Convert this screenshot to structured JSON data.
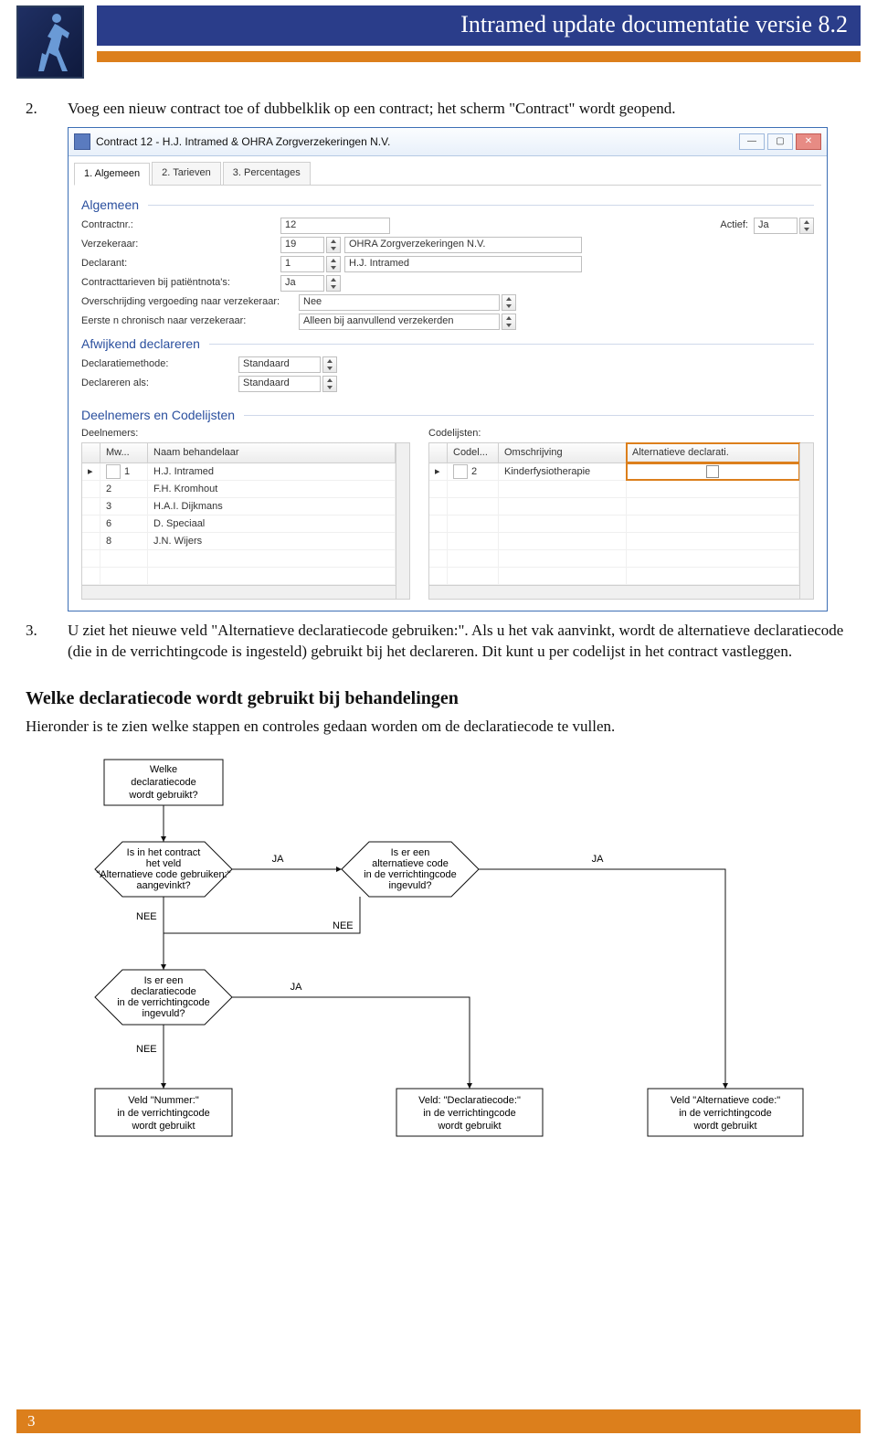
{
  "header": {
    "title": "Intramed update documentatie versie 8.2"
  },
  "steps": {
    "s2_num": "2.",
    "s2_text": "Voeg een nieuw contract toe of dubbelklik op een contract; het scherm \"Contract\" wordt geopend.",
    "s3_num": "3.",
    "s3_text": "U ziet het nieuwe veld \"Alternatieve declaratiecode gebruiken:\". Als u het vak aanvinkt, wordt de alternatieve declaratiecode (die in de verrichtingcode is ingesteld) gebruikt bij het declareren. Dit kunt u per codelijst in het contract vastleggen."
  },
  "dialog": {
    "title": "Contract 12 - H.J. Intramed & OHRA Zorgverzekeringen N.V.",
    "tabs": [
      "1. Algemeen",
      "2. Tarieven",
      "3. Percentages"
    ],
    "section_algemeen": "Algemeen",
    "section_afwijkend": "Afwijkend declareren",
    "section_deelnemers": "Deelnemers en Codelijsten",
    "fields": {
      "contractnr_lbl": "Contractnr.:",
      "contractnr_val": "12",
      "actief_lbl": "Actief:",
      "actief_val": "Ja",
      "verzekeraar_lbl": "Verzekeraar:",
      "verzekeraar_val": "19",
      "verzekeraar_name": "OHRA Zorgverzekeringen N.V.",
      "declarant_lbl": "Declarant:",
      "declarant_val": "1",
      "declarant_name": "H.J. Intramed",
      "contracttarieven_lbl": "Contracttarieven bij patiëntnota's:",
      "contracttarieven_val": "Ja",
      "overschrijding_lbl": "Overschrijding vergoeding naar verzekeraar:",
      "overschrijding_val": "Nee",
      "eerste_lbl": "Eerste n chronisch naar verzekeraar:",
      "eerste_val": "Alleen bij aanvullend verzekerden",
      "declmeth_lbl": "Declaratiemethode:",
      "declmeth_val": "Standaard",
      "declals_lbl": "Declareren als:",
      "declals_val": "Standaard"
    },
    "deelnemers": {
      "label": "Deelnemers:",
      "cols": [
        "Mw...",
        "Naam behandelaar"
      ],
      "rows": [
        {
          "id": "1",
          "name": "H.J. Intramed"
        },
        {
          "id": "2",
          "name": "F.H. Kromhout"
        },
        {
          "id": "3",
          "name": "H.A.I. Dijkmans"
        },
        {
          "id": "6",
          "name": "D. Speciaal"
        },
        {
          "id": "8",
          "name": "J.N. Wijers"
        }
      ]
    },
    "codelijsten": {
      "label": "Codelijsten:",
      "cols": [
        "Codel...",
        "Omschrijving",
        "Alternatieve declarati."
      ],
      "rows": [
        {
          "id": "2",
          "desc": "Kinderfysiotherapie"
        }
      ]
    }
  },
  "section2": {
    "heading": "Welke declaratiecode wordt gebruikt bij behandelingen",
    "intro": "Hieronder is te zien welke stappen en controles gedaan worden om de declaratiecode te vullen."
  },
  "flow": {
    "start_l1": "Welke",
    "start_l2": "declaratiecode",
    "start_l3": "wordt gebruikt?",
    "d1_l1": "Is in het contract",
    "d1_l2": "het veld",
    "d1_l3": "\"Alternatieve code gebruiken:\"",
    "d1_l4": "aangevinkt?",
    "d2_l1": "Is er een",
    "d2_l2": "alternatieve code",
    "d2_l3": "in de verrichtingcode",
    "d2_l4": "ingevuld?",
    "d3_l1": "Is er een",
    "d3_l2": "declaratiecode",
    "d3_l3": "in de verrichtingcode",
    "d3_l4": "ingevuld?",
    "r1_l1": "Veld \"Nummer:\"",
    "r1_l2": "in de verrichtingcode",
    "r1_l3": "wordt gebruikt",
    "r2_l1": "Veld: \"Declaratiecode:\"",
    "r2_l2": "in de verrichtingcode",
    "r2_l3": "wordt gebruikt",
    "r3_l1": "Veld \"Alternatieve code:\"",
    "r3_l2": "in de verrichtingcode",
    "r3_l3": "wordt gebruikt",
    "ja": "JA",
    "nee": "NEE"
  },
  "footer": {
    "page": "3"
  }
}
